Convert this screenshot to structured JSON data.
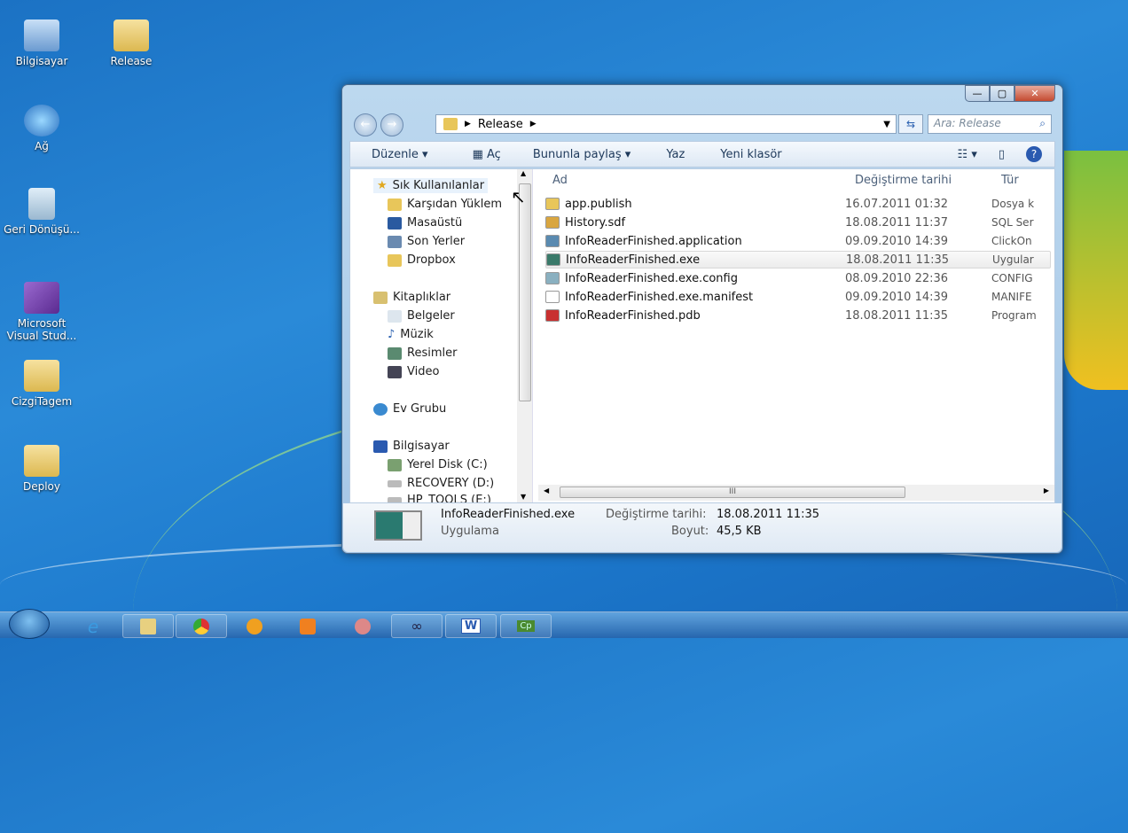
{
  "desktop": {
    "icons": [
      "Bilgisayar",
      "Release",
      "Ağ",
      "Geri Dönüşü...",
      "Microsoft Visual Stud...",
      "CizgiTagem",
      "Deploy"
    ]
  },
  "window": {
    "controls": {
      "minimize": "—",
      "maximize": "▢",
      "close": "✕"
    },
    "address": {
      "path": "Release",
      "search_placeholder": "Ara: Release"
    },
    "toolbar": {
      "organize": "Düzenle ▾",
      "open": "Aç",
      "share": "Bununla paylaş ▾",
      "burn": "Yaz",
      "new_folder": "Yeni klasör"
    },
    "nav": {
      "favorites": "Sık Kullanılanlar",
      "downloads": "Karşıdan Yüklem",
      "desktop": "Masaüstü",
      "recent": "Son Yerler",
      "dropbox": "Dropbox",
      "libraries": "Kitaplıklar",
      "documents": "Belgeler",
      "music": "Müzik",
      "pictures": "Resimler",
      "video": "Video",
      "homegroup": "Ev Grubu",
      "computer": "Bilgisayar",
      "disk_c": "Yerel Disk (C:)",
      "disk_d": "RECOVERY (D:)",
      "disk_e": "HP_TOOLS (E:)"
    },
    "columns": {
      "name": "Ad",
      "date": "Değiştirme tarihi",
      "type": "Tür"
    },
    "files": [
      {
        "name": "app.publish",
        "date": "16.07.2011 01:32",
        "type": "Dosya k",
        "icon": "folder-icon",
        "color": "#e8c65a"
      },
      {
        "name": "History.sdf",
        "date": "18.08.2011 11:37",
        "type": "SQL Ser",
        "icon": "database-file-icon",
        "color": "#d9a640"
      },
      {
        "name": "InfoReaderFinished.application",
        "date": "09.09.2010 14:39",
        "type": "ClickOn",
        "icon": "application-manifest-icon",
        "color": "#5a8ab0"
      },
      {
        "name": "InfoReaderFinished.exe",
        "date": "18.08.2011 11:35",
        "type": "Uygular",
        "icon": "exe-icon",
        "color": "#3a7a6a"
      },
      {
        "name": "InfoReaderFinished.exe.config",
        "date": "08.09.2010 22:36",
        "type": "CONFIG",
        "icon": "config-file-icon",
        "color": "#8ab0c0"
      },
      {
        "name": "InfoReaderFinished.exe.manifest",
        "date": "09.09.2010 14:39",
        "type": "MANIFE",
        "icon": "file-icon",
        "color": "#ffffff"
      },
      {
        "name": "InfoReaderFinished.pdb",
        "date": "18.08.2011 11:35",
        "type": "Program",
        "icon": "pdb-file-icon",
        "color": "#c83030"
      }
    ],
    "details": {
      "filename": "InfoReaderFinished.exe",
      "kind": "Uygulama",
      "date_label": "Değiştirme tarihi:",
      "date": "18.08.2011 11:35",
      "size_label": "Boyut:",
      "size": "45,5 KB"
    }
  },
  "taskbar": {
    "items": [
      "internet-explorer",
      "explorer",
      "chrome",
      "orange-app",
      "media-player",
      "paint-app",
      "link-app",
      "word",
      "captivate"
    ],
    "word": "W",
    "captivate": "Cp"
  }
}
